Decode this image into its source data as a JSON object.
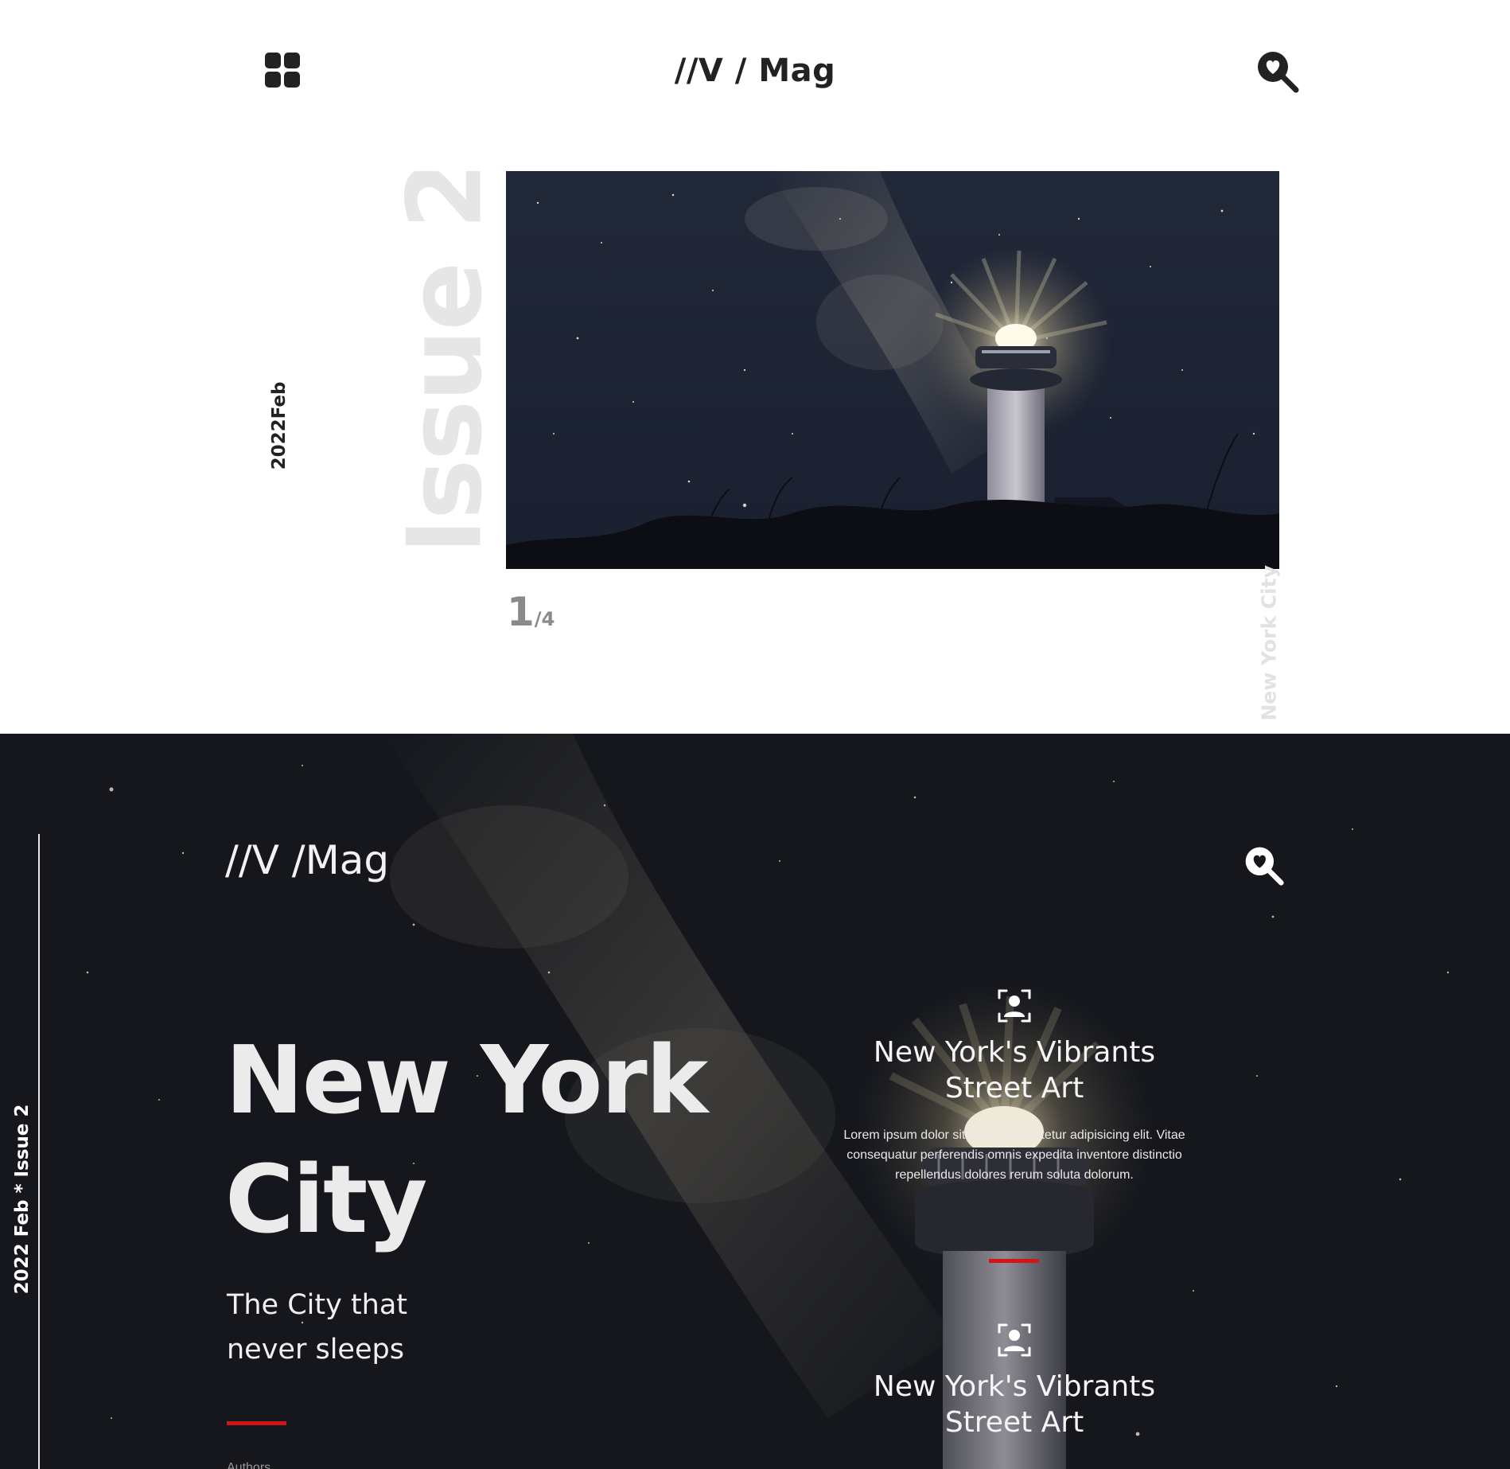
{
  "top": {
    "brand": "//V / Mag",
    "date_label": "2022Feb",
    "issue_label": "Issue 2",
    "pager": {
      "current": "1",
      "total": "/4"
    },
    "location_label": "New York City"
  },
  "bottom": {
    "brand": "//V /Mag",
    "side_label": "2022 Feb * Issue 2",
    "headline": "New York City",
    "subline": "The City that never sleeps",
    "authors_label": "Authors",
    "cards": [
      {
        "title": "New York's Vibrants Street Art",
        "body": "Lorem ipsum dolor sit amet consectetur adipisicing elit. Vitae consequatur perferendis omnis expedita inventore distinctio repellendus dolores rerum soluta dolorum."
      },
      {
        "title": "New York's Vibrants Street Art"
      }
    ]
  },
  "icons": {
    "menu": "grid-menu-icon",
    "search": "search-heart-icon",
    "person": "person-frame-icon"
  },
  "colors": {
    "accent_red": "#d01616",
    "dark_bg": "#15171d",
    "issue_text": "#e6e6e6",
    "pager_text": "#8a8a8a"
  }
}
